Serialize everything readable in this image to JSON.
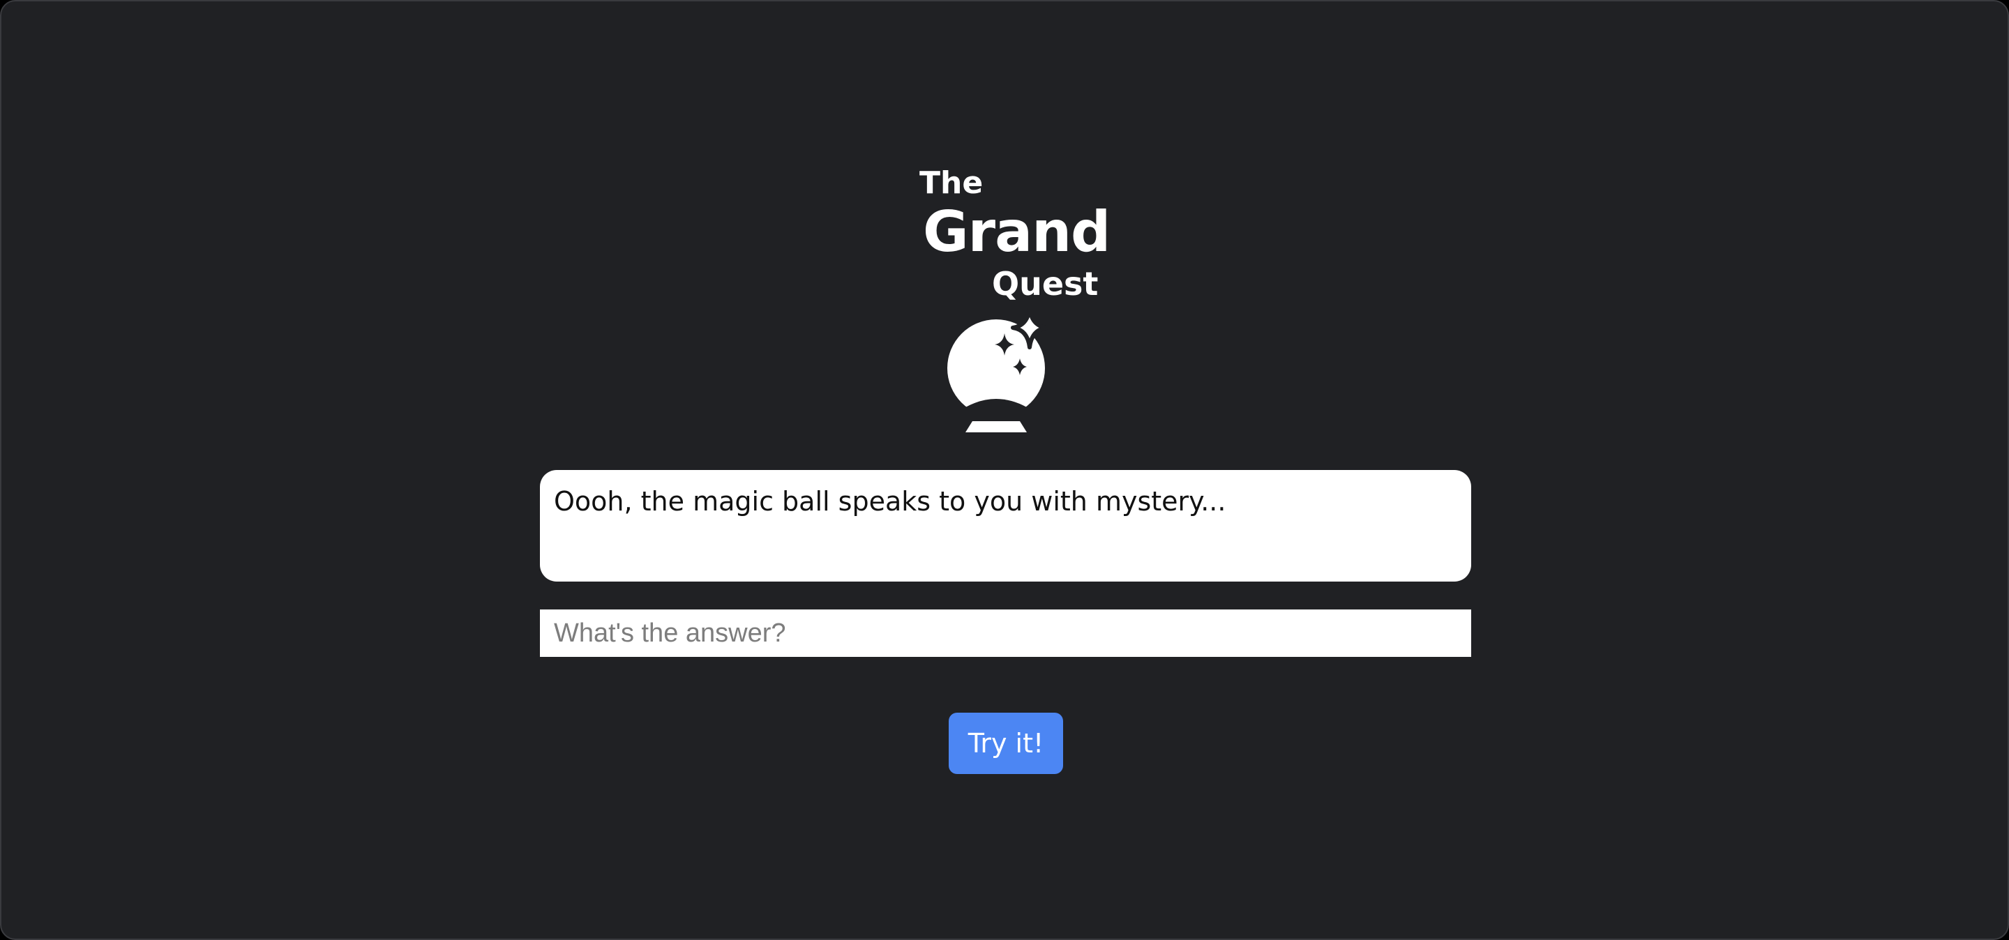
{
  "logo": {
    "line1": "The",
    "line2": "Grand",
    "line3": "Quest",
    "icon": "crystal-ball-icon"
  },
  "message": {
    "text": "Oooh, the magic ball speaks to you with mystery..."
  },
  "answer": {
    "value": "",
    "placeholder": "What's the answer?"
  },
  "submit": {
    "label": "Try it!"
  },
  "colors": {
    "background": "#202124",
    "accent": "#4c86f3",
    "text_light": "#ffffff"
  }
}
